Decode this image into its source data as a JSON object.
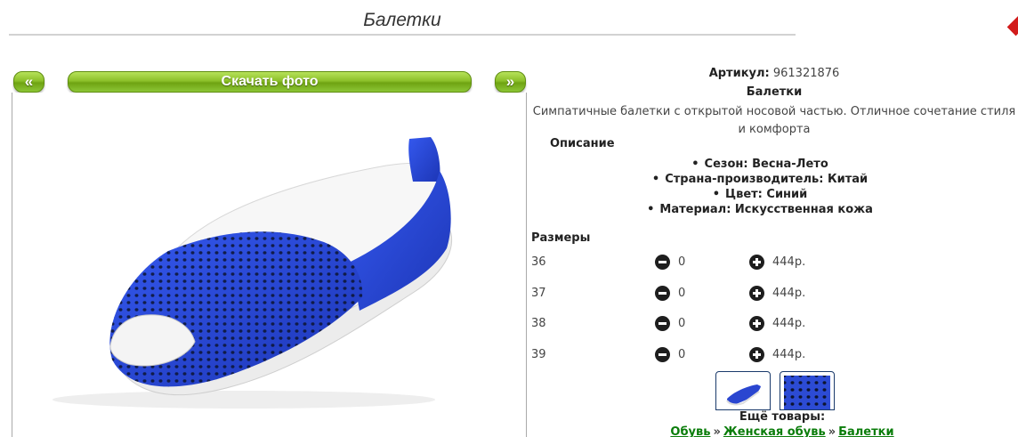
{
  "page": {
    "title": "Балетки"
  },
  "gallery": {
    "prev_label": "«",
    "next_label": "»",
    "download_label": "Скачать фото"
  },
  "product": {
    "article_label": "Артикул:",
    "article_value": "961321876",
    "name": "Балетки",
    "description": "Симпатичные балетки с открытой носовой частью. Отличное сочетание стиля и комфорта",
    "description_heading": "Описание",
    "specs": [
      "Сезон: Весна-Лето",
      "Страна-производитель: Китай",
      "Цвет: Синий",
      "Материал: Искусственная кожа"
    ]
  },
  "sizes": {
    "heading": "Размеры",
    "rows": [
      {
        "size": "36",
        "qty": "0",
        "price": "444р."
      },
      {
        "size": "37",
        "qty": "0",
        "price": "444р."
      },
      {
        "size": "38",
        "qty": "0",
        "price": "444р."
      },
      {
        "size": "39",
        "qty": "0",
        "price": "444р."
      }
    ]
  },
  "more": {
    "heading": "Ещё товары:",
    "crumbs": [
      "Обувь",
      "Женская обувь",
      "Балетки"
    ],
    "separator": "»"
  },
  "colors": {
    "accent_green": "#7db21e",
    "shoe_blue": "#2440c8",
    "link_green": "#0b7d0b"
  }
}
